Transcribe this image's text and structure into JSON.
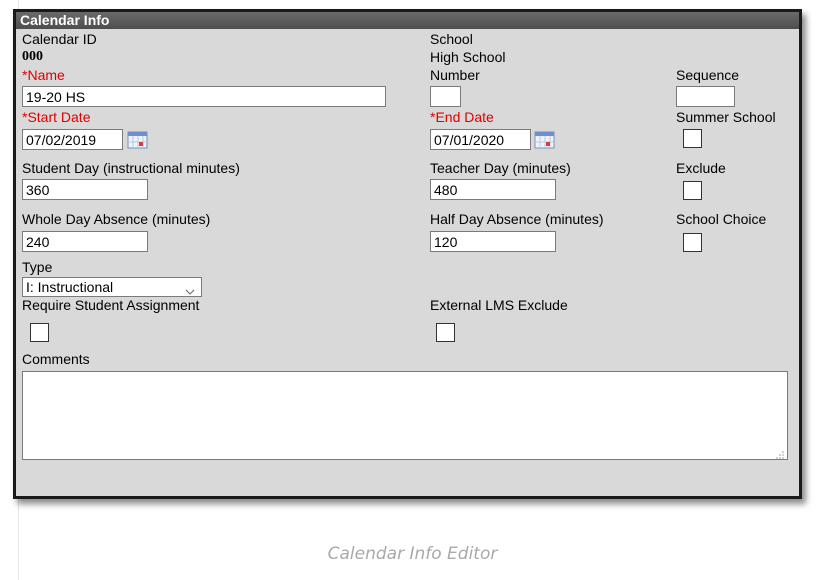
{
  "panel": {
    "title": "Calendar Info"
  },
  "fields": {
    "calendar_id": {
      "label": "Calendar ID",
      "value": "000"
    },
    "school": {
      "label": "School",
      "value": "High School"
    },
    "name": {
      "required_mark": "*",
      "label": "Name",
      "value": "19-20 HS"
    },
    "number": {
      "label": "Number",
      "value": ""
    },
    "sequence": {
      "label": "Sequence",
      "value": ""
    },
    "start_date": {
      "required_mark": "*",
      "label": "Start Date",
      "value": "07/02/2019"
    },
    "end_date": {
      "required_mark": "*",
      "label": "End Date",
      "value": "07/01/2020"
    },
    "summer_school": {
      "label": "Summer School",
      "checked": false
    },
    "student_day": {
      "label": "Student Day (instructional minutes)",
      "value": "360"
    },
    "teacher_day": {
      "label": "Teacher Day (minutes)",
      "value": "480"
    },
    "exclude": {
      "label": "Exclude",
      "checked": false
    },
    "whole_day_absence": {
      "label": "Whole Day Absence (minutes)",
      "value": "240"
    },
    "half_day_absence": {
      "label": "Half Day Absence (minutes)",
      "value": "120"
    },
    "school_choice": {
      "label": "School Choice",
      "checked": false
    },
    "type": {
      "label": "Type",
      "value": "I: Instructional"
    },
    "require_student_assignment": {
      "label": "Require Student Assignment",
      "checked": false
    },
    "external_lms_exclude": {
      "label": "External LMS Exclude",
      "checked": false
    },
    "comments": {
      "label": "Comments",
      "value": ""
    }
  },
  "icons": {
    "calendar_button": "calendar-icon",
    "select_chevron": "chevron-down-icon",
    "resize_grip": "resize-grip-icon"
  },
  "colors": {
    "required": "#e00000",
    "panel_bg": "#d9d9d9",
    "header_bg": "#5a5a5a"
  },
  "caption": "Calendar Info Editor"
}
